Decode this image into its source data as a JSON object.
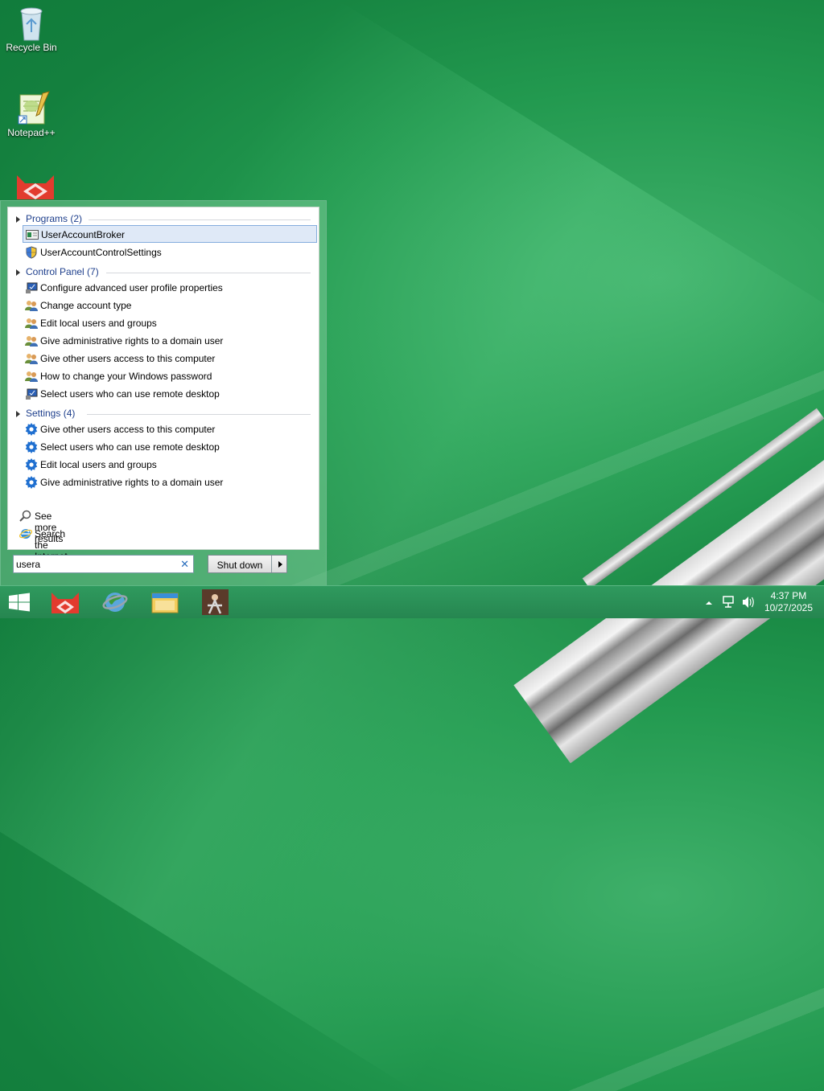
{
  "desktop": {
    "icons": [
      {
        "label": "Recycle Bin",
        "icon": "recycle-bin-icon"
      },
      {
        "label": "Notepad++",
        "icon": "notepad-plus-plus-icon"
      },
      {
        "label": "",
        "icon": "app-cat-icon"
      }
    ]
  },
  "start_menu": {
    "groups": [
      {
        "label": "Programs (2)",
        "items": [
          {
            "label": "UserAccountBroker",
            "icon": "app-window-icon",
            "selected": true
          },
          {
            "label": "UserAccountControlSettings",
            "icon": "uac-shield-icon"
          }
        ]
      },
      {
        "label": "Control Panel (7)",
        "items": [
          {
            "label": "Configure advanced user profile properties",
            "icon": "system-monitor-icon"
          },
          {
            "label": "Change account type",
            "icon": "users-icon"
          },
          {
            "label": "Edit local users and groups",
            "icon": "users-icon"
          },
          {
            "label": "Give administrative rights to a domain user",
            "icon": "users-icon"
          },
          {
            "label": "Give other users access to this computer",
            "icon": "users-icon"
          },
          {
            "label": "How to change your Windows password",
            "icon": "users-icon"
          },
          {
            "label": "Select users who can use remote desktop",
            "icon": "system-monitor-icon"
          }
        ]
      },
      {
        "label": "Settings (4)",
        "items": [
          {
            "label": "Give other users access to this computer",
            "icon": "gear-icon"
          },
          {
            "label": "Select users who can use remote desktop",
            "icon": "gear-icon"
          },
          {
            "label": "Edit local users and groups",
            "icon": "gear-icon"
          },
          {
            "label": "Give administrative rights to a domain user",
            "icon": "gear-icon"
          }
        ]
      }
    ],
    "see_more": "See more results",
    "search_internet": "Search the Internet",
    "search_value": "usera",
    "shutdown_label": "Shut down"
  },
  "taskbar": {
    "apps": [
      "start-windows-icon",
      "app-cat-icon",
      "browser-globe-icon",
      "file-explorer-icon",
      "bookmark-app-icon"
    ],
    "clock_time": "4:37 PM",
    "clock_date": "10/27/2025"
  },
  "colors": {
    "group_header": "#1e3f8c",
    "selected_bg": "#dfe9f7",
    "taskbar": "#2f9a5e"
  }
}
